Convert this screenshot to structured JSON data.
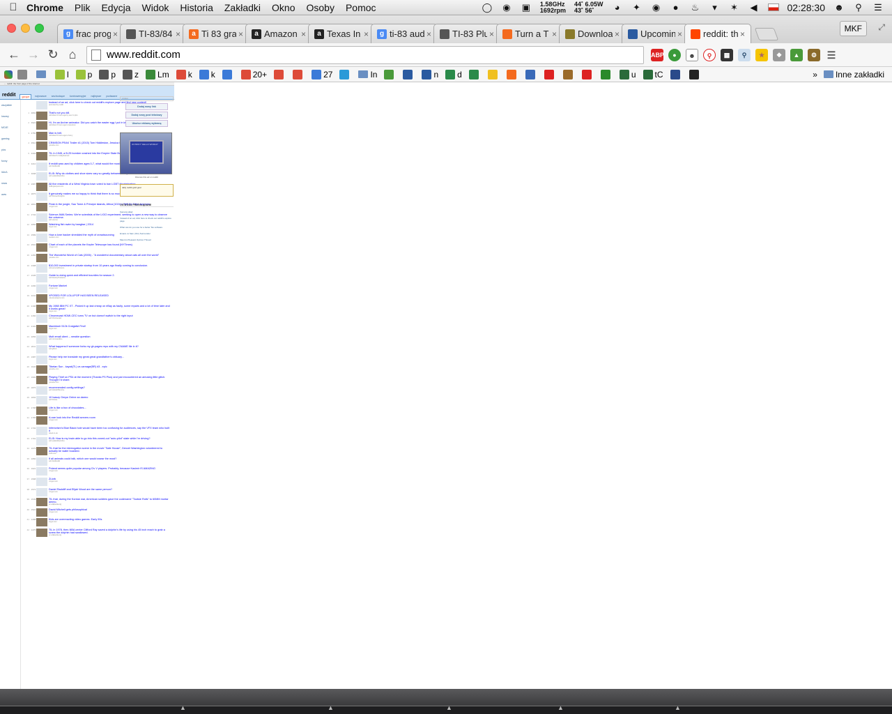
{
  "menubar": {
    "app": "Chrome",
    "menus": [
      "Plik",
      "Edycja",
      "Widok",
      "Historia",
      "Zakładki",
      "Okno",
      "Osoby",
      "Pomoc"
    ],
    "cpu": "1.58GHz",
    "mem": "1692rpm",
    "temp1": "44˚",
    "temp2": "43˚",
    "power": "6.05W",
    "fan": "56˚",
    "clock": "02:28:30"
  },
  "tabs": [
    {
      "title": "frac prog",
      "fav": "g",
      "color": "#4a8af4"
    },
    {
      "title": "TI-83/84",
      "fav": "",
      "color": "#555555"
    },
    {
      "title": "Ti 83 gra",
      "fav": "a",
      "color": "#f46a1e"
    },
    {
      "title": "Amazon",
      "fav": "a",
      "color": "#222222"
    },
    {
      "title": "Texas In",
      "fav": "a",
      "color": "#222222"
    },
    {
      "title": "ti-83 aud",
      "fav": "g",
      "color": "#4a8af4"
    },
    {
      "title": "TI-83 Plu",
      "fav": "",
      "color": "#555555"
    },
    {
      "title": "Turn a T",
      "fav": "",
      "color": "#f46a1e"
    },
    {
      "title": "Downloa",
      "fav": "",
      "color": "#8a7a2a"
    },
    {
      "title": "Upcomin",
      "fav": "",
      "color": "#2a5aa0"
    },
    {
      "title": "reddit: th",
      "fav": "",
      "color": "#ff4500",
      "active": true
    }
  ],
  "profile": "MKF",
  "url": "www.reddit.com",
  "bookmarks": [
    {
      "label": "",
      "color": "#888888",
      "folder": false
    },
    {
      "label": "",
      "color": "#6a8fc2",
      "folder": true
    },
    {
      "label": "l",
      "color": "#9ac23a"
    },
    {
      "label": "p",
      "color": "#9ac23a"
    },
    {
      "label": "p",
      "color": "#555555"
    },
    {
      "label": "z",
      "color": "#555555"
    },
    {
      "label": "Lm",
      "color": "#3a8a3a"
    },
    {
      "label": "k",
      "color": "#dd4b39"
    },
    {
      "label": "k",
      "color": "#3b7ad8"
    },
    {
      "label": "",
      "color": "#3b7ad8"
    },
    {
      "label": "20+",
      "color": "#dd4b39"
    },
    {
      "label": "",
      "color": "#dd4b39"
    },
    {
      "label": "",
      "color": "#dd4b39"
    },
    {
      "label": "27",
      "color": "#3b7ad8"
    },
    {
      "label": "",
      "color": "#2a9ad8"
    },
    {
      "label": "In",
      "color": "#6a8fc2",
      "folder": true
    },
    {
      "label": "",
      "color": "#4a9a3a"
    },
    {
      "label": "",
      "color": "#2a5aa0"
    },
    {
      "label": "n",
      "color": "#2a5aa0"
    },
    {
      "label": "d",
      "color": "#2a8a4a"
    },
    {
      "label": "",
      "color": "#2a8a4a"
    },
    {
      "label": "",
      "color": "#f0c020"
    },
    {
      "label": "",
      "color": "#f46a1e"
    },
    {
      "label": "",
      "color": "#3a6ab8"
    },
    {
      "label": "",
      "color": "#dd2222"
    },
    {
      "label": "",
      "color": "#9a6a2a"
    },
    {
      "label": "",
      "color": "#dd2222"
    },
    {
      "label": "",
      "color": "#2a8a2a"
    },
    {
      "label": "u",
      "color": "#2a6a3a"
    },
    {
      "label": "tC",
      "color": "#2a6a3a"
    },
    {
      "label": "",
      "color": "#2a4a8a"
    },
    {
      "label": "",
      "color": "#222222"
    }
  ],
  "bookmarks_more": "»",
  "other_bookmarks": "Inne zakładki",
  "reddit": {
    "logo": "reddit",
    "topbar": "← reddit: the front page of the internet",
    "tabs": [
      "gorące",
      "najnowsze",
      "wschodzące",
      "kontrowersyjne",
      "najlepsze",
      "pozłacane"
    ],
    "sidebar_items": [
      "wszystkie",
      "losowy",
      "MOJE",
      "gaming",
      "pics",
      "funny",
      "IAmA",
      "news",
      "aww"
    ],
    "search_placeholder": "szukaj",
    "side_buttons": [
      "Dodaj nowy link",
      "Dodaj nowy post tekstowy",
      "Ukończ reklamę wybraną"
    ],
    "ad_screen": "20 PRINT \"HELLO WORLD\"",
    "ad_caption": "Discuss this ad on reddit",
    "gold_text": "daily reddit gold goal",
    "recent_head": "OSTATNIO PRZEGLĄDANE",
    "recent": [
      "Kamara sklad",
      "Instead of an ad, click here to check out reddit's explore page",
      "What can do you use for a better Tax software",
      "Emacs vs Sam (Vim) Surrounder",
      "Mauro's Pleasant Opinion Thread"
    ],
    "posts": [
      {
        "title": "Instead of an ad, click here to check out reddit's explore page and find new content!",
        "meta": "promoted by reddit",
        "votes": "",
        "thumb": "self"
      },
      {
        "title": "That's not you kill.",
        "meta": "submitted 4 hours ago by user to pics",
        "votes": "4802",
        "thumb": "img"
      },
      {
        "title": "Hi, I'm an Archer animator. Did you catch the easter egg I put in last night's episode?",
        "meta": "submitted 3 hours ago to television",
        "votes": "3921",
        "thumb": "img"
      },
      {
        "title": "Man is hell.",
        "meta": "submitted 5 hours ago to funny",
        "votes": "3750",
        "thumb": "img"
      },
      {
        "title": "CRIMSON PEAK Trailer #1 (2015) Tom Hiddleston, Jessica Chastain - Directed by Guillermo Del Toro",
        "meta": "youtube.com",
        "votes": "3510",
        "thumb": "img"
      },
      {
        "title": "TIL In 1945, a B-25 bomber crashed into the Empire State Building's elevator shaft, snapping the cables.",
        "meta": "submitted to todayilearned",
        "votes": "3402",
        "thumb": "img"
      },
      {
        "title": "If reddit was used by children ages 0-7, what would the most popular TIL, AMA, and ELI5s be?",
        "meta": "self.AskReddit",
        "votes": "3210",
        "thumb": "self"
      },
      {
        "title": "ELI5: Why do clothes and shoe sizes vary so greatly between companies?",
        "meta": "self.explainlikeimfive",
        "votes": "3098",
        "thumb": "self"
      },
      {
        "title": "All five residents of a West Virginia town voted to ban LGBT discrimination",
        "meta": "huffingtonpost.com",
        "votes": "2987",
        "thumb": "img"
      },
      {
        "title": "It genuinely makes me so happy to think that there is so much music out there I have yet to discover",
        "meta": "self.Showerthoughts",
        "votes": "2876",
        "thumb": "self"
      },
      {
        "title": "Peak in the jungle, Sao Tome & Principe islands, Africa [1024 x 768] By Filipe Azevedo",
        "meta": "i.imgur.com",
        "votes": "2801",
        "thumb": "img"
      },
      {
        "title": "Science AMA Series: We're scientists of the LIGO experiment, seeking to open a new way to observe the universe.",
        "meta": "self.science",
        "votes": "2734",
        "thumb": "self"
      },
      {
        "title": "Watching fish swim by bangbar | 2014",
        "meta": "imgur.com",
        "votes": "2650",
        "thumb": "img"
      },
      {
        "title": "How a lone hacker shredded the myth of crowdsourcing",
        "meta": "medium.com",
        "votes": "2589",
        "thumb": "self"
      },
      {
        "title": "Chart of each of the planets the Kepler Telescope has found (NYTimes)",
        "meta": "i.imgur.com",
        "votes": "2501",
        "thumb": "img"
      },
      {
        "title": "The Wonderful World of Cats (2006) - \"A wonderful documentary about cats all over the world\"",
        "meta": "youtube.com",
        "votes": "2456",
        "thumb": "img"
      },
      {
        "title": "$10,000 investment in private startup from 10 years ago finally coming to conclusion.",
        "meta": "self.personalfinance",
        "votes": "2398",
        "thumb": "self"
      },
      {
        "title": "Guide to doing quick and efficient bounties for season 2.",
        "meta": "self.DestinyTheGame",
        "votes": "2345",
        "thumb": "self"
      },
      {
        "title": "Fortune Market",
        "meta": "i.imgur.com",
        "votes": "2290",
        "thumb": "self"
      },
      {
        "title": "XPOSED FOR LOLLIPOP HAS BEEN RELEASED",
        "meta": "xda-developers.com",
        "votes": "2241",
        "thumb": "img"
      },
      {
        "title": "My 1988 IBM PC XT - Picked it up last cheap on eBay as faulty, some repairs and a lot of time later and it works great!",
        "meta": "imgur.com",
        "votes": "2198",
        "thumb": "img"
      },
      {
        "title": "Chromecast HDMI-CEC turns TV on but doesn't switch to the right input",
        "meta": "self.Chromecast",
        "votes": "2150",
        "thumb": "self"
      },
      {
        "title": "Macintosh 512k Craigslist Find!",
        "meta": "imgur.com",
        "votes": "2102",
        "thumb": "img"
      },
      {
        "title": "Mutt email client -- newbie question",
        "meta": "self.commandline",
        "votes": "2056",
        "thumb": "self"
      },
      {
        "title": "What happens if someone forks my gh-pages repo with my CNAME file in it?",
        "meta": "self.github",
        "votes": "2011",
        "thumb": "self"
      },
      {
        "title": "Please help me translate my great great grandfather's obituary...",
        "meta": "imgur.com",
        "votes": "1987",
        "thumb": "self"
      },
      {
        "title": "Tibetan Sun - kayak(TL) vs carnage(BR) #3 - epic",
        "meta": "youtube.com",
        "votes": "1943",
        "thumb": "img"
      },
      {
        "title": "Playing Thief on PS4 at the moment (Thanks PS Plus) and just encountered an amusing little glitch. Thought I'd share.",
        "meta": "youtube.com",
        "votes": "1902",
        "thumb": "img"
      },
      {
        "title": "recommended config settings?",
        "meta": "self.GlobalOffensive",
        "votes": "1876",
        "thumb": "self"
      },
      {
        "title": "10 Isaszy Gmyw Orrine za darmo",
        "meta": "self.Polska",
        "votes": "1834",
        "thumb": "self"
      },
      {
        "title": "Life is like a box of chocolates...",
        "meta": "i.imgur.com",
        "votes": "1798",
        "thumb": "img"
      },
      {
        "title": "A rare look into the Reddit servers room",
        "meta": "i.imgur.com",
        "votes": "1765",
        "thumb": "img"
      },
      {
        "title": "Inferiorism's Blue Black hole would have been too confusing for audiences, say the VFX team who built it",
        "meta": "wired.co.uk",
        "votes": "1732",
        "thumb": "self"
      },
      {
        "title": "ELI5: How is my brain able to go into this zoned-out \"auto-pilot\" state while I'm driving?",
        "meta": "self.explainlikeimfive",
        "votes": "1701",
        "thumb": "self"
      },
      {
        "title": "TIL that for the interrogation scene in the movie \"Safe House\", Denzel Washington volunteered to actually be water boarded.",
        "meta": "imdb.com",
        "votes": "1676",
        "thumb": "img"
      },
      {
        "title": "If all animals could talk, which one would swear the most?",
        "meta": "self.AskReddit",
        "votes": "1650",
        "thumb": "self"
      },
      {
        "title": "Poland seems quite popular among Civ V players. Probably, because Kasimir IS AMAZING",
        "meta": "i.imgur.com",
        "votes": "1621",
        "thumb": "self"
      },
      {
        "title": "Zi-kek",
        "meta": "i.imgur.com",
        "votes": "1598",
        "thumb": "self"
      },
      {
        "title": "Daniel Radcliff and Elijah Wood are the same person?",
        "meta": "i.imgur.com",
        "votes": "1572",
        "thumb": "self"
      },
      {
        "title": "TIL that, during the Korean war, American soldiers gave the codename \"Tootsie Rolls\" to 60MM mortar ammo.",
        "meta": "en.wikipedia.org",
        "votes": "1549",
        "thumb": "img"
      },
      {
        "title": "David Mitchell gets philosophical",
        "meta": "i.imgur.com",
        "votes": "1521",
        "thumb": "img"
      },
      {
        "title": "Kids are overreacting video games: Early 90s",
        "meta": "imgur.com",
        "votes": "1498",
        "thumb": "img"
      },
      {
        "title": "TIL in 1978, then-NBA center Clifford Ray saved a dolphin's life by using his 45 inch reach to grab a screw the dolphin had swallowed.",
        "meta": "en.wikipedia.org",
        "votes": "1476",
        "thumb": "img"
      }
    ]
  }
}
